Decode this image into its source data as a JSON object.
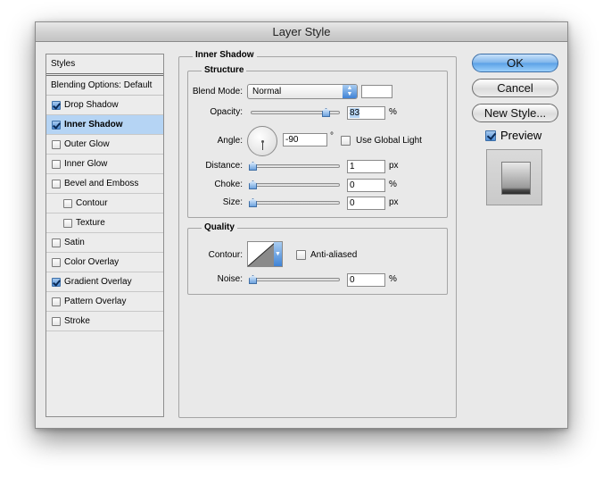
{
  "window": {
    "title": "Layer Style"
  },
  "styles_list": {
    "header": "Styles",
    "blending_options": "Blending Options: Default",
    "items": [
      {
        "label": "Drop Shadow",
        "checked": true,
        "selected": false,
        "indent": false
      },
      {
        "label": "Inner Shadow",
        "checked": true,
        "selected": true,
        "indent": false
      },
      {
        "label": "Outer Glow",
        "checked": false,
        "selected": false,
        "indent": false
      },
      {
        "label": "Inner Glow",
        "checked": false,
        "selected": false,
        "indent": false
      },
      {
        "label": "Bevel and Emboss",
        "checked": false,
        "selected": false,
        "indent": false
      },
      {
        "label": "Contour",
        "checked": false,
        "selected": false,
        "indent": true
      },
      {
        "label": "Texture",
        "checked": false,
        "selected": false,
        "indent": true
      },
      {
        "label": "Satin",
        "checked": false,
        "selected": false,
        "indent": false
      },
      {
        "label": "Color Overlay",
        "checked": false,
        "selected": false,
        "indent": false
      },
      {
        "label": "Gradient Overlay",
        "checked": true,
        "selected": false,
        "indent": false
      },
      {
        "label": "Pattern Overlay",
        "checked": false,
        "selected": false,
        "indent": false
      },
      {
        "label": "Stroke",
        "checked": false,
        "selected": false,
        "indent": false
      }
    ]
  },
  "inner_shadow": {
    "title": "Inner Shadow",
    "structure": {
      "title": "Structure",
      "blend_mode_label": "Blend Mode:",
      "blend_mode_value": "Normal",
      "shadow_color": "#ffffff",
      "opacity_label": "Opacity:",
      "opacity_value": "83",
      "opacity_unit": "%",
      "opacity_level": 0.83,
      "angle_label": "Angle:",
      "angle_value": "-90",
      "angle_unit": "°",
      "use_global_light_label": "Use Global Light",
      "use_global_light_checked": false,
      "distance_label": "Distance:",
      "distance_value": "1",
      "distance_unit": "px",
      "choke_label": "Choke:",
      "choke_value": "0",
      "choke_unit": "%",
      "size_label": "Size:",
      "size_value": "0",
      "size_unit": "px"
    },
    "quality": {
      "title": "Quality",
      "contour_label": "Contour:",
      "anti_aliased_label": "Anti-aliased",
      "anti_aliased_checked": false,
      "noise_label": "Noise:",
      "noise_value": "0",
      "noise_unit": "%"
    }
  },
  "buttons": {
    "ok": "OK",
    "cancel": "Cancel",
    "new_style": "New Style..."
  },
  "preview": {
    "label": "Preview",
    "checked": true
  },
  "colors": {
    "selection": "#b5d4f4",
    "accent": "#5aa0e6"
  }
}
